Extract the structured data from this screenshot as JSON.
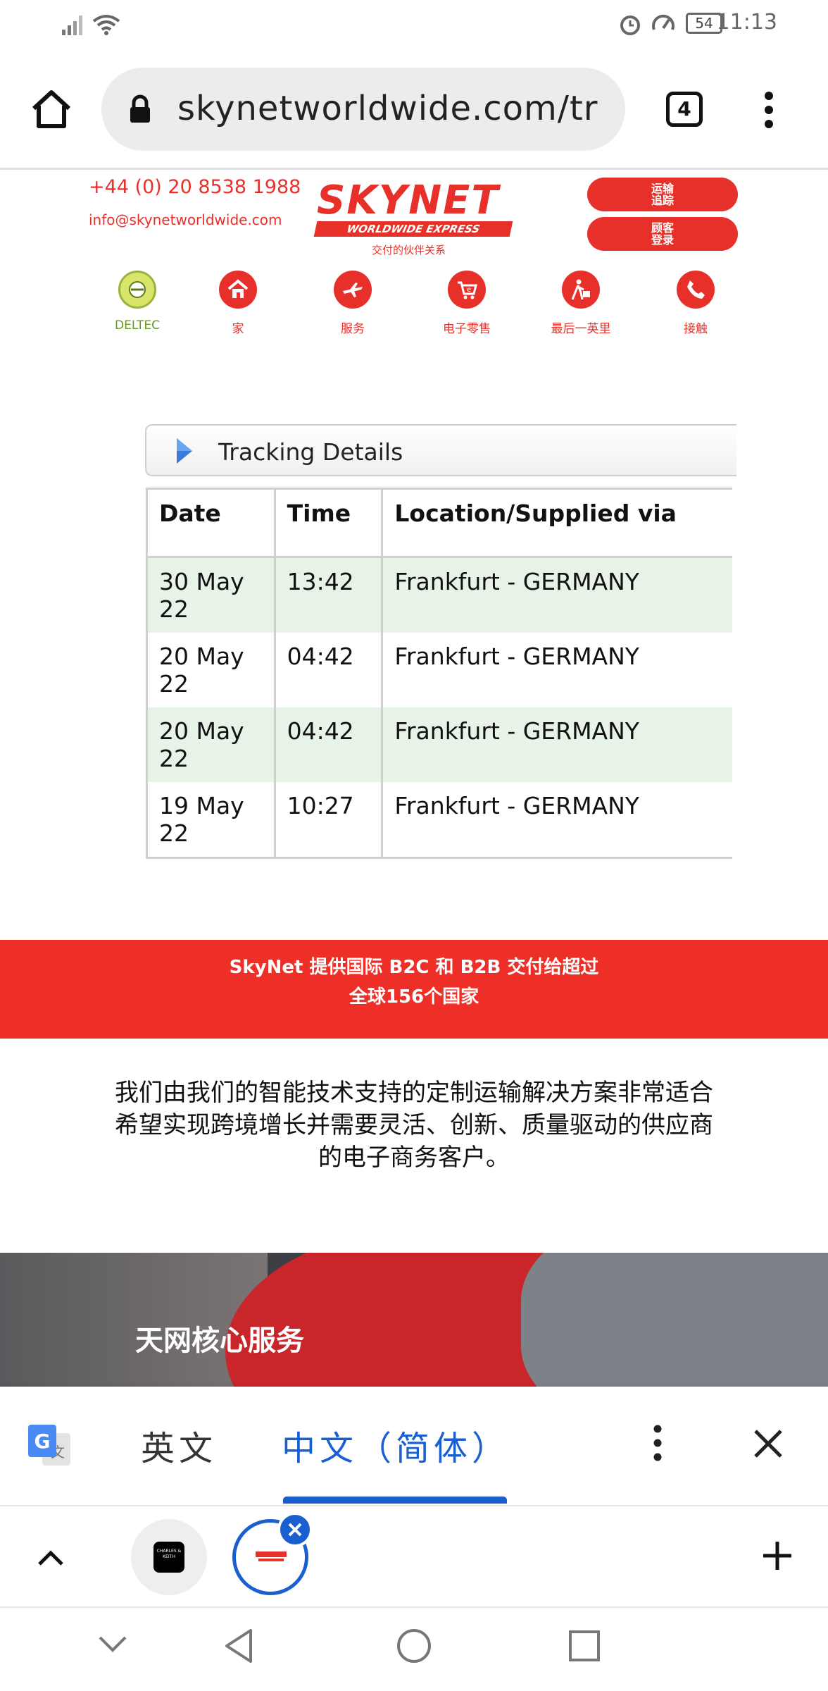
{
  "status_bar": {
    "time": "11:13",
    "battery": "54"
  },
  "browser": {
    "url": "skynetworldwide.com/tr",
    "tab_count": "4"
  },
  "site_header": {
    "phone": "+44 (0) 20 8538 1988",
    "email": "info@skynetworldwide.com",
    "logo_top": "SKYNET",
    "logo_band": "WORLDWIDE EXPRESS",
    "tagline": "交付的伙伴关系",
    "btn_tracking": "运输\n追踪",
    "btn_login": "顾客\n登录"
  },
  "nav": [
    {
      "label": "DELTEC",
      "icon": "deltec-icon"
    },
    {
      "label": "家",
      "icon": "home-icon"
    },
    {
      "label": "服务",
      "icon": "plane-icon"
    },
    {
      "label": "电子零售",
      "icon": "ecommerce-icon"
    },
    {
      "label": "最后一英里",
      "icon": "courier-icon"
    },
    {
      "label": "接触",
      "icon": "phone-icon"
    }
  ],
  "tracking": {
    "title": "Tracking Details",
    "columns": [
      "Date",
      "Time",
      "Location/Supplied via"
    ],
    "rows": [
      {
        "date": "30 May 22",
        "time": "13:42",
        "location": "Frankfurt - GERMANY"
      },
      {
        "date": "20 May 22",
        "time": "04:42",
        "location": "Frankfurt - GERMANY"
      },
      {
        "date": "20 May 22",
        "time": "04:42",
        "location": "Frankfurt - GERMANY"
      },
      {
        "date": "19 May 22",
        "time": "10:27",
        "location": "Frankfurt - GERMANY"
      }
    ]
  },
  "banner": {
    "line1": "SkyNet 提供国际 B2C 和 B2B 交付给超过",
    "line2": "全球156个国家"
  },
  "intro_paragraph": "我们由我们的智能技术支持的定制运输解决方案非常适合希望实现跨境增长并需要灵活、创新、质量驱动的供应商的电子商务客户。",
  "hero": {
    "title": "天网核心服务"
  },
  "translate_bar": {
    "source_lang": "英文",
    "target_lang": "中文（简体）"
  },
  "tab_strip": {
    "thumb1_text": "CHARLES & KEITH"
  },
  "colors": {
    "brand_red": "#e8302a",
    "accent_blue": "#1a5fd0",
    "row_alt": "#e8f3e8"
  }
}
